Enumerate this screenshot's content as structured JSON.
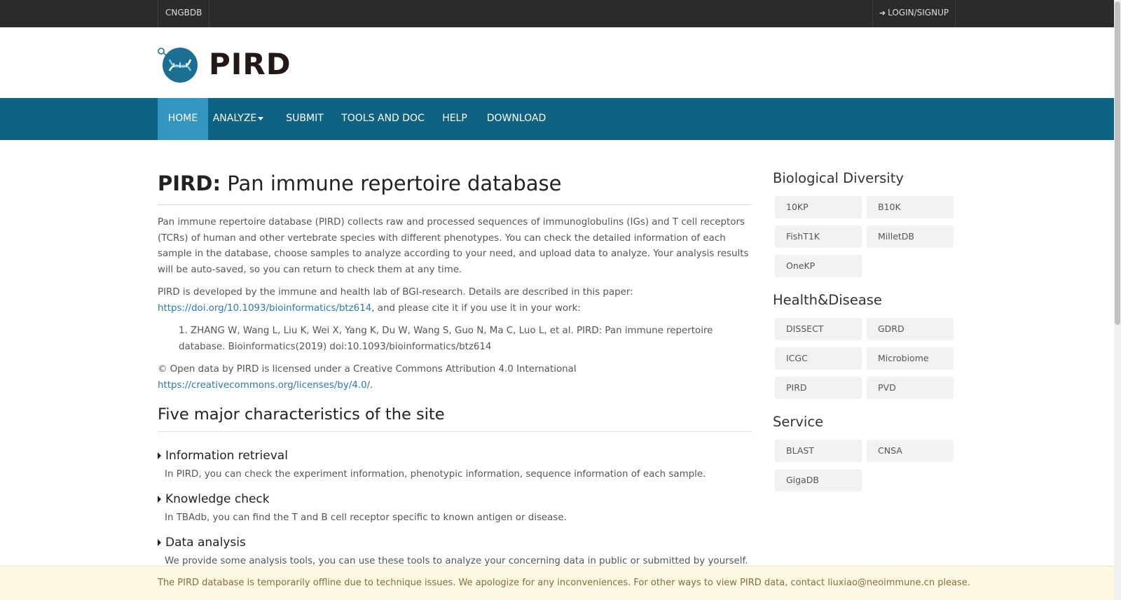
{
  "topbar": {
    "brand": "CNGBDB",
    "login": "LOGIN/SIGNUP"
  },
  "logo": {
    "text": "PIRD"
  },
  "nav": [
    {
      "label": "HOME"
    },
    {
      "label": "ANALYZE"
    },
    {
      "label": "SUBMIT"
    },
    {
      "label": "TOOLS AND DOC"
    },
    {
      "label": "HELP"
    },
    {
      "label": "DOWNLOAD"
    }
  ],
  "main": {
    "title_bold": "PIRD:",
    "title_rest": " Pan immune repertoire database",
    "intro": "Pan immune repertoire database (PIRD) collects raw and processed sequences of immunoglobulins (IGs) and T cell receptors (TCRs) of human and other vertebrate species with different phenotypes. You can check the detailed information of each sample in the database, choose samples to analyze according to your need, and upload data to analyze. Your analysis results will be auto-saved, so you can return to check them at any time.",
    "dev_text": "PIRD is developed by the immune and health lab of BGI-research. Details are described in this paper:",
    "dev_link": "https://doi.org/10.1093/bioinformatics/btz614",
    "dev_suffix": ", and please cite it if you use it in your work:",
    "reference": "1. ZHANG W, Wang L, Liu K, Wei X, Yang K, Du W, Wang S, Guo N, Ma C, Luo L, et al. PIRD: Pan immune repertoire database. Bioinformatics(2019) doi:10.1093/bioinformatics/btz614",
    "license_text": "© Open data by PIRD is licensed under a Creative Commons Attribution 4.0 International",
    "license_link": "https://creativecommons.org/licenses/by/4.0/",
    "license_suffix": ".",
    "section_title": "Five major characteristics of the site",
    "features": [
      {
        "title": "Information retrieval",
        "desc": "In PIRD, you can check the experiment information, phenotypic information, sequence information of each sample."
      },
      {
        "title": "Knowledge check",
        "desc": "In TBAdb, you can find the T and B cell receptor specific to known antigen or disease."
      },
      {
        "title": "Data analysis",
        "desc": "We provide some analysis tools, you can use these tools to analyze your concerning data in public or submitted by yourself."
      }
    ]
  },
  "sidebar": {
    "groups": [
      {
        "heading": "Biological Diversity",
        "items": [
          "10KP",
          "B10K",
          "FishT1K",
          "MilletDB",
          "OneKP"
        ]
      },
      {
        "heading": "Health&Disease",
        "items": [
          "DISSECT",
          "GDRD",
          "ICGC",
          "Microbiome",
          "PIRD",
          "PVD"
        ]
      },
      {
        "heading": "Service",
        "items": [
          "BLAST",
          "CNSA",
          "GigaDB"
        ]
      }
    ]
  },
  "alert": {
    "text": "The PIRD database is temporarily offline due to technique issues. We apologize for any inconveniences. For other ways to view PIRD data, contact liuxiao@neoimmune.cn please."
  },
  "colors": {
    "topbar": "#2b2b2b",
    "navbar": "#0f6282",
    "nav_active": "#3396c0",
    "link": "#2a7ab5",
    "alert_bg": "#fcf8e3",
    "alert_text": "#8a6d3b"
  }
}
